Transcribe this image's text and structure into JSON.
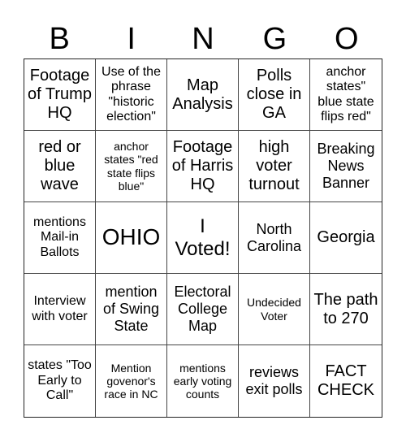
{
  "header": {
    "letters": [
      "B",
      "I",
      "N",
      "G",
      "O"
    ]
  },
  "board": {
    "cells": [
      "Footage of Trump HQ",
      "Use of the phrase \"historic election\"",
      "Map Analysis",
      "Polls close in GA",
      "anchor states\" blue state flips red\"",
      "red or blue wave",
      "anchor states \"red state flips blue\"",
      "Footage of Harris HQ",
      "high voter turnout",
      "Breaking News Banner",
      "mentions Mail-in Ballots",
      "OHIO",
      "I Voted!",
      "North Carolina",
      "Georgia",
      "Interview with voter",
      "mention of Swing State",
      "Electoral College Map",
      "Undecided Voter",
      "The path to 270",
      "states \"Too Early to Call\"",
      "Mention govenor's race in NC",
      "mentions early voting counts",
      "reviews exit polls",
      "FACT CHECK"
    ]
  }
}
